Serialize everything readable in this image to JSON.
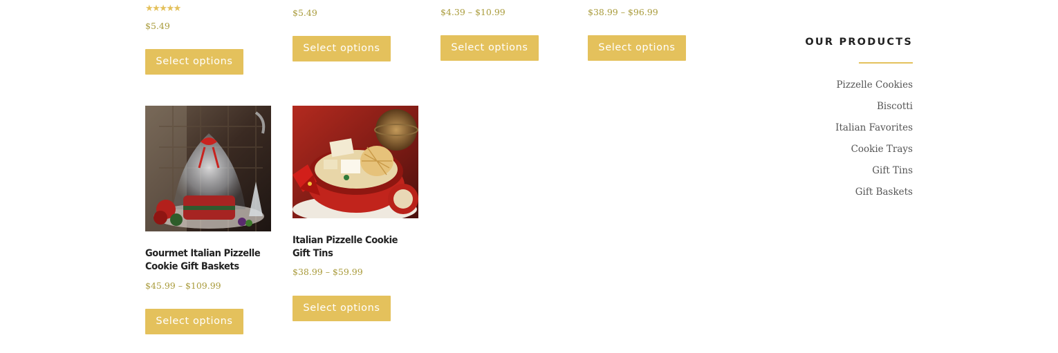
{
  "products_row1": [
    {
      "rating_stars": "★★★★★",
      "rating_value": 5,
      "price": "$5.49",
      "button": "Select options"
    },
    {
      "price": "$5.49",
      "button": "Select options"
    },
    {
      "price": "$4.39 – $10.99",
      "button": "Select options"
    },
    {
      "price": "$38.99 – $96.99",
      "button": "Select options"
    }
  ],
  "products_row2": [
    {
      "title": "Gourmet Italian Pizzelle Cookie Gift Baskets",
      "price": "$45.99 – $109.99",
      "button": "Select options",
      "image": "gift-basket-photo"
    },
    {
      "title": "Italian Pizzelle Cookie Gift Tins",
      "price": "$38.99 – $59.99",
      "button": "Select options",
      "image": "cookie-tin-photo"
    }
  ],
  "sidebar": {
    "title": "OUR PRODUCTS",
    "links": [
      "Pizzelle Cookies",
      "Biscotti",
      "Italian Favorites",
      "Cookie Trays",
      "Gift Tins",
      "Gift Baskets"
    ]
  },
  "colors": {
    "accent": "#e4c15c",
    "price": "#a99b3b",
    "title": "#222222",
    "link": "#555555"
  }
}
